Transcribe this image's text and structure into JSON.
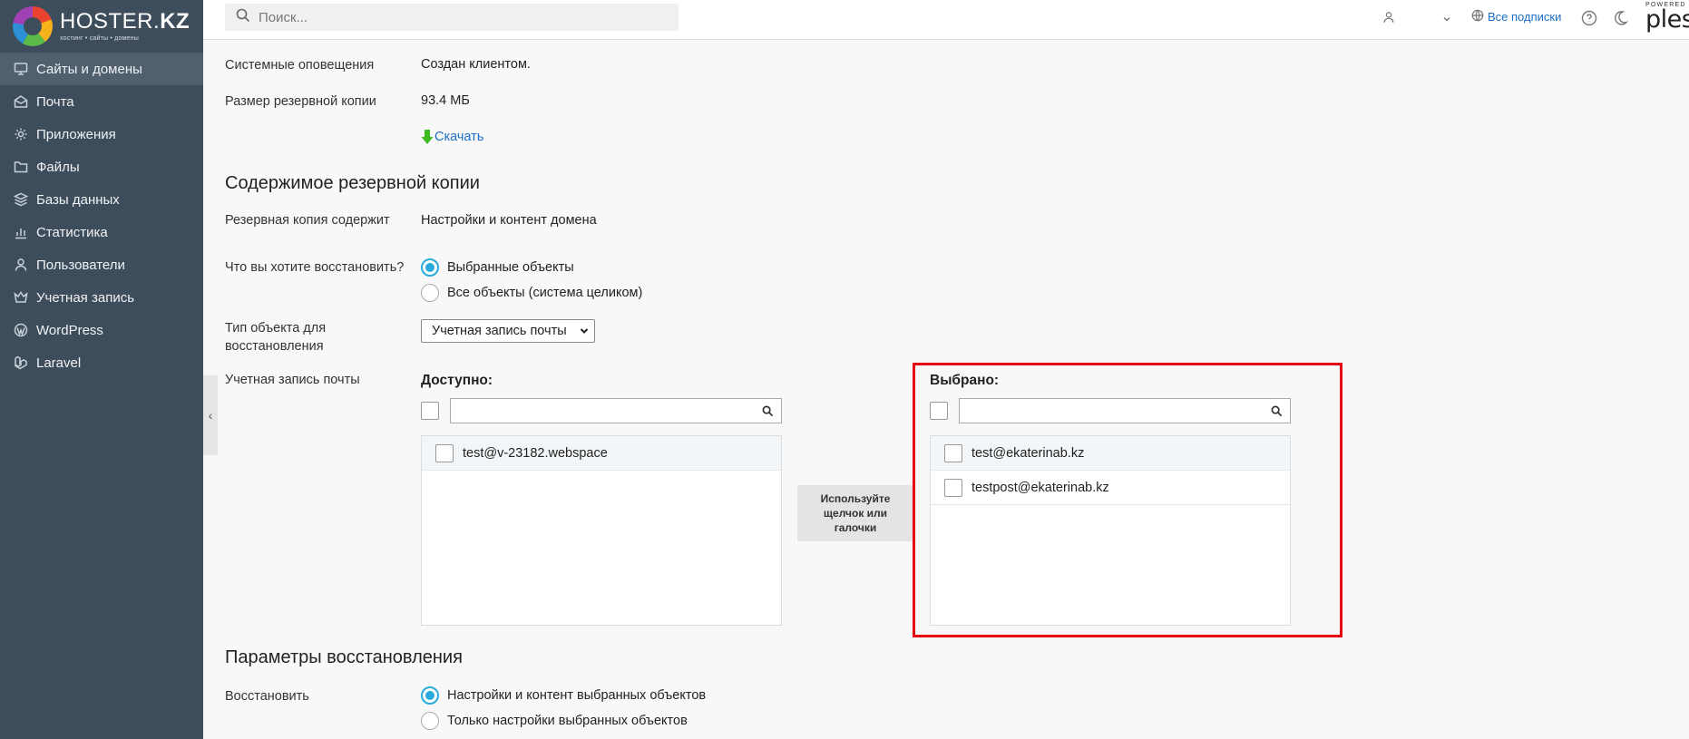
{
  "brand": {
    "name_light": "HOSTER.",
    "name_bold": "KZ",
    "tagline": "хостинг • сайты • домены"
  },
  "sidebar": {
    "items": [
      {
        "label": "Сайты и домены",
        "icon": "monitor-icon",
        "active": true
      },
      {
        "label": "Почта",
        "icon": "mail-icon"
      },
      {
        "label": "Приложения",
        "icon": "gear-icon"
      },
      {
        "label": "Файлы",
        "icon": "folder-icon"
      },
      {
        "label": "Базы данных",
        "icon": "database-icon"
      },
      {
        "label": "Статистика",
        "icon": "bar-chart-icon"
      },
      {
        "label": "Пользователи",
        "icon": "user-icon"
      },
      {
        "label": "Учетная запись",
        "icon": "crown-icon"
      },
      {
        "label": "WordPress",
        "icon": "wordpress-icon"
      },
      {
        "label": "Laravel",
        "icon": "laravel-icon"
      }
    ],
    "collapse_glyph": "‹"
  },
  "header": {
    "search_placeholder": "Поиск...",
    "subscriptions_label": "Все подписки",
    "powered_label": "POWERED",
    "plesk_label": "ples"
  },
  "details": {
    "notifications_label": "Системные оповещения",
    "notifications_value": "Создан клиентом.",
    "size_label": "Размер резервной копии",
    "size_value": "93.4 МБ",
    "download_label": "Скачать"
  },
  "contents": {
    "title": "Содержимое резервной копии",
    "contains_label": "Резервная копия содержит",
    "contains_value": "Настройки и контент домена",
    "what_label": "Что вы хотите восстановить?",
    "what_options": [
      {
        "label": "Выбранные объекты",
        "checked": true
      },
      {
        "label": "Все объекты (система целиком)",
        "checked": false
      }
    ],
    "type_label": "Тип объекта для восстановления",
    "type_value": "Учетная запись почты",
    "account_label": "Учетная запись почты",
    "available": {
      "title": "Доступно:",
      "items": [
        "test@v-23182.webspace"
      ]
    },
    "selected": {
      "title": "Выбрано:",
      "items": [
        "test@ekaterinab.kz",
        "testpost@ekaterinab.kz"
      ]
    },
    "hint": "Используйте щелчок или галочки"
  },
  "restore": {
    "title": "Параметры восстановления",
    "label": "Восстановить",
    "options": [
      {
        "label": "Настройки и контент выбранных объектов",
        "checked": true
      },
      {
        "label": "Только настройки выбранных объектов",
        "checked": false
      }
    ]
  },
  "colors": {
    "sidebar": "#3e4d5c",
    "accent": "#28aade",
    "link": "#1b6fc6",
    "highlight": "#e60012"
  }
}
